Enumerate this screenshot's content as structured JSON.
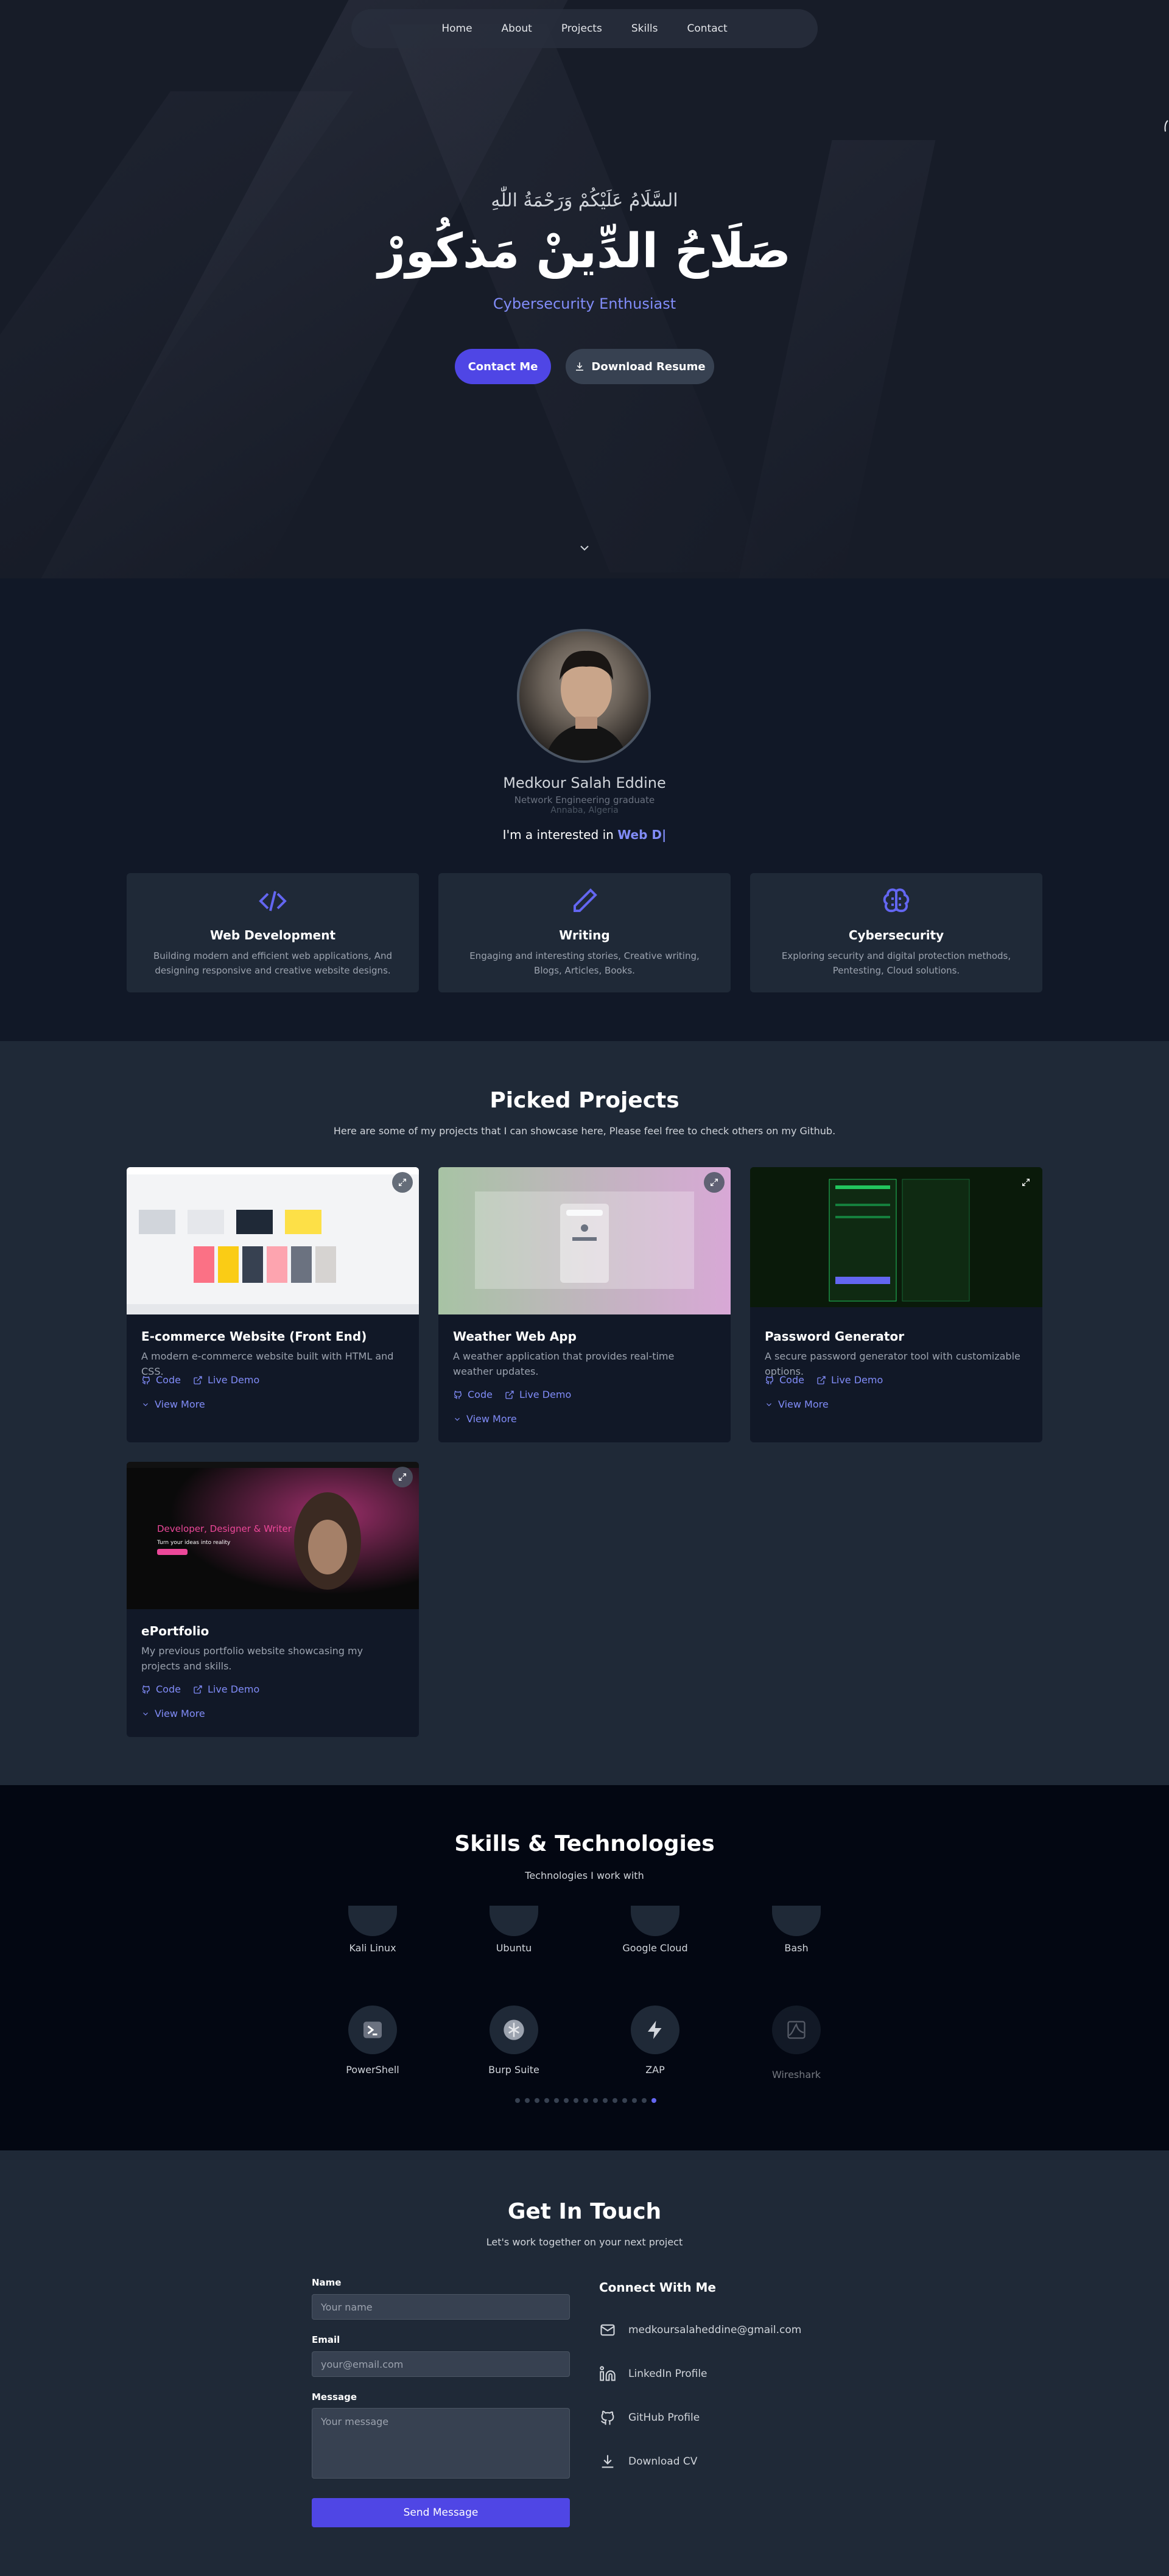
{
  "nav": {
    "items": [
      "Home",
      "About",
      "Projects",
      "Skills",
      "Contact"
    ]
  },
  "hero": {
    "greeting": "السَّلَامُ عَلَيْكُمْ وَرَحْمَةُ اللّٰهِ",
    "name": "صَلَاحُ الدِّينْ مَذكُورْ",
    "subtitle": "Cybersecurity Enthusiast",
    "contact_button": "Contact Me",
    "resume_button": "Download Resume"
  },
  "about": {
    "name": "Medkour Salah Eddine",
    "role": "Network Engineering graduate",
    "location": "Annaba, Algeria",
    "interest_prefix": "I'm a interested in",
    "interest_typed": "Web D|",
    "cards": [
      {
        "icon": "code-icon",
        "title": "Web Development",
        "desc": "Building modern and efficient web applications, And designing responsive and creative website designs."
      },
      {
        "icon": "pencil-icon",
        "title": "Writing",
        "desc": "Engaging and interesting stories, Creative writing, Blogs, Articles, Books."
      },
      {
        "icon": "brain-icon",
        "title": "Cybersecurity",
        "desc": "Exploring security and digital protection methods, Pentesting, Cloud solutions."
      }
    ]
  },
  "projects": {
    "title": "Picked Projects",
    "subtitle": "Here are some of my projects that I can showcase here, Please feel free to check others on my Github.",
    "code_label": "Code",
    "demo_label": "Live Demo",
    "view_more_label": "View More",
    "items": [
      {
        "title": "E-commerce Website (Front End)",
        "desc": "A modern e-commerce website built with HTML and CSS."
      },
      {
        "title": "Weather Web App",
        "desc": "A weather application that provides real-time weather updates."
      },
      {
        "title": "Password Generator",
        "desc": "A secure password generator tool with customizable options."
      },
      {
        "title": "ePortfolio",
        "desc": "My previous portfolio website showcasing my projects and skills.",
        "banner_text": "Developer, Designer & Writer",
        "banner_sub": "Turn your ideas into reality"
      }
    ]
  },
  "skills": {
    "title": "Skills & Technologies",
    "subtitle": "Technologies I work with",
    "row1": [
      "Kali Linux",
      "Ubuntu",
      "Google Cloud",
      "Bash"
    ],
    "row2": [
      "PowerShell",
      "Burp Suite",
      "ZAP",
      "Wireshark"
    ],
    "dot_count": 15,
    "active_dot": 14
  },
  "contact": {
    "title": "Get In Touch",
    "subtitle": "Let's work together on your next project",
    "name_label": "Name",
    "name_placeholder": "Your name",
    "email_label": "Email",
    "email_placeholder": "your@email.com",
    "message_label": "Message",
    "message_placeholder": "Your message",
    "send_label": "Send Message",
    "connect_title": "Connect With Me",
    "links": [
      {
        "icon": "mail-icon",
        "label": "medkoursalaheddine@gmail.com"
      },
      {
        "icon": "linkedin-icon",
        "label": "LinkedIn Profile"
      },
      {
        "icon": "github-icon",
        "label": "GitHub Profile"
      },
      {
        "icon": "download-icon",
        "label": "Download CV"
      }
    ]
  },
  "colors": {
    "accent": "#4f46e5",
    "accent_light": "#818cf8",
    "bg_dark": "#111827",
    "bg_panel": "#1f2937"
  }
}
